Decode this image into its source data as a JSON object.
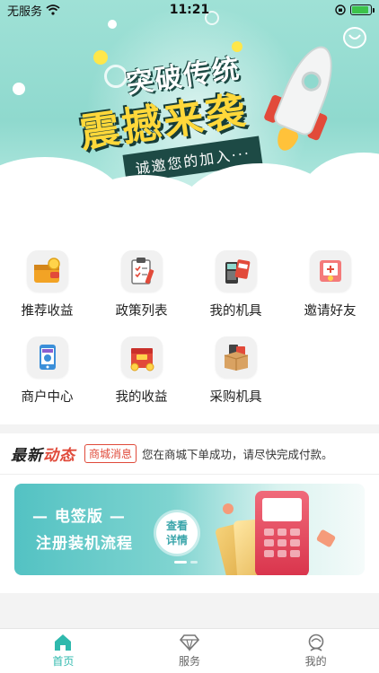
{
  "status_bar": {
    "carrier": "无服务",
    "time": "11:21",
    "battery_level": 0.9
  },
  "banner": {
    "title_line1": "突破传统",
    "title_line2": "震撼来袭",
    "subtitle": "诚邀您的加入···"
  },
  "menu": {
    "items": [
      {
        "label": "推荐收益",
        "icon": "wallet-coin-icon"
      },
      {
        "label": "政策列表",
        "icon": "clipboard-checklist-icon"
      },
      {
        "label": "我的机具",
        "icon": "pos-terminal-icon"
      },
      {
        "label": "邀请好友",
        "icon": "invite-envelope-icon"
      },
      {
        "label": "商户中心",
        "icon": "merchant-phone-icon"
      },
      {
        "label": "我的收益",
        "icon": "earnings-gift-box-icon"
      },
      {
        "label": "采购机具",
        "icon": "purchase-box-icon"
      }
    ]
  },
  "news": {
    "brand_prefix": "最新",
    "brand_suffix": "动态",
    "tag": "商城消息",
    "text": "您在商城下单成功，请尽快完成付款。"
  },
  "promo": {
    "line1": "— 电签版 —",
    "line2": "注册装机流程",
    "button": "查看详情"
  },
  "tabbar": {
    "items": [
      {
        "label": "首页",
        "icon": "home-icon",
        "active": true
      },
      {
        "label": "服务",
        "icon": "diamond-service-icon",
        "active": false
      },
      {
        "label": "我的",
        "icon": "user-profile-icon",
        "active": false
      }
    ]
  },
  "colors": {
    "accent": "#2fb9ad",
    "news_tag": "#e04a3a"
  }
}
